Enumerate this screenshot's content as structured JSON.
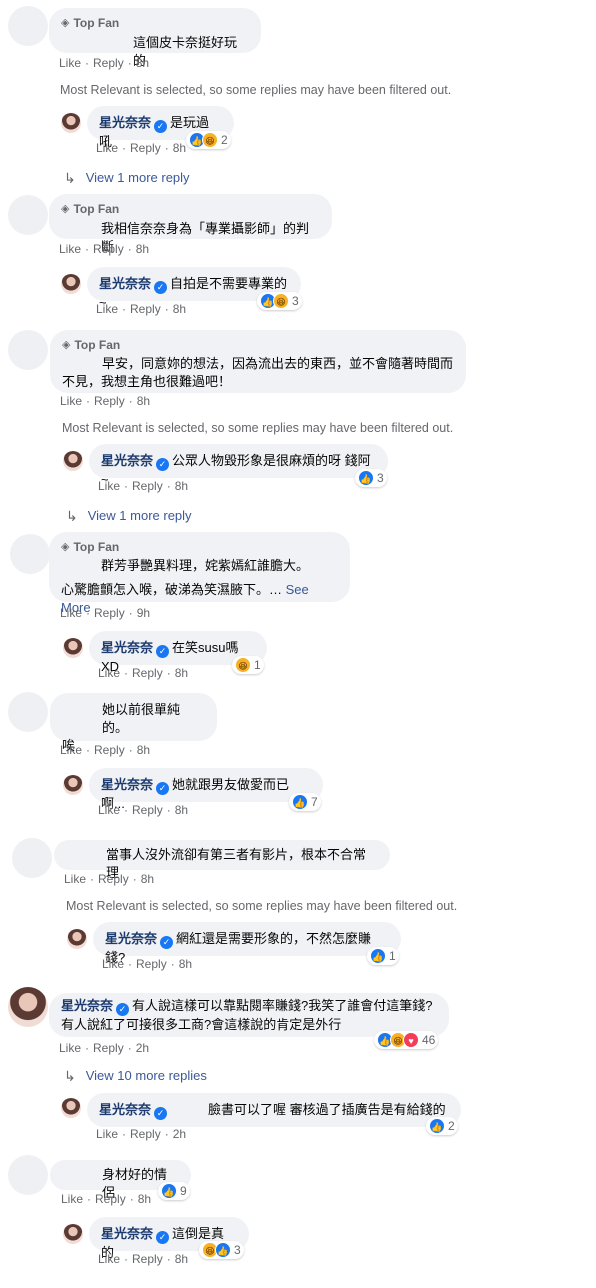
{
  "labels": {
    "top_fan": "Top Fan",
    "like": "Like",
    "reply": "Reply",
    "filtered": "Most Relevant is selected, so some replies may have been filtered out.",
    "see_more": "See More",
    "user": "星光奈奈"
  },
  "comments": [
    {
      "text": "這個皮卡奈挺好玩的",
      "time": "8h"
    },
    {
      "text": "是玩過吼",
      "time": "8h",
      "reactions": "2"
    },
    {
      "view_more": "View 1 more reply"
    },
    {
      "text": "我相信奈奈身為「專業攝影師」的判斷",
      "time": "8h"
    },
    {
      "text": "自拍是不需要專業的~",
      "time": "8h",
      "reactions": "3"
    },
    {
      "text1": "早安，同意妳的想法，因為流出去的東西，並不會隨著時間而",
      "text2": "不見，我想主角也很難過吧！",
      "time": "8h"
    },
    {
      "text": "公眾人物毀形象是很麻煩的呀 錢阿~",
      "time": "8h",
      "reactions": "3"
    },
    {
      "view_more": "View 1 more reply"
    },
    {
      "text1": "群芳爭艷異料理，姹紫嫣紅誰膽大。",
      "text2": "心驚膽顫怎入喉，破涕為笑濕腋下。…",
      "time": "9h"
    },
    {
      "text": "在笑susu嗎XD",
      "time": "8h",
      "reactions": "1"
    },
    {
      "text1": "她以前很單純的。",
      "text2": "唉",
      "time": "8h"
    },
    {
      "text": "她就跟男友做愛而已啊...",
      "time": "8h",
      "reactions": "7"
    },
    {
      "text": "當事人沒外流卻有第三者有影片，根本不合常理",
      "time": "8h"
    },
    {
      "text": "網紅還是需要形象的，不然怎麼賺錢?",
      "time": "8h",
      "reactions": "1"
    },
    {
      "text1": "有人說這樣可以靠點閱率賺錢?我笑了誰會付這筆錢?",
      "text2": "有人說紅了可接很多工商?會這樣說的肯定是外行",
      "time": "2h",
      "reactions": "46"
    },
    {
      "view_more": "View 10 more replies"
    },
    {
      "text": "臉書可以了喔 審核過了插廣告是有給錢的",
      "time": "2h",
      "reactions": "2"
    },
    {
      "text": "身材好的情侶",
      "time": "8h",
      "reactions": "9"
    },
    {
      "text": "這倒是真的",
      "time": "8h",
      "reactions": "3"
    }
  ],
  "colors": {
    "link": "#385898",
    "bubble": "#f0f2f5",
    "like": "#1877f2",
    "haha": "#f7b125",
    "love": "#f33e58"
  },
  "icons": [
    "diamond-icon",
    "verified-icon",
    "reply-arrow-icon",
    "like-reaction-icon",
    "haha-reaction-icon",
    "love-reaction-icon"
  ]
}
